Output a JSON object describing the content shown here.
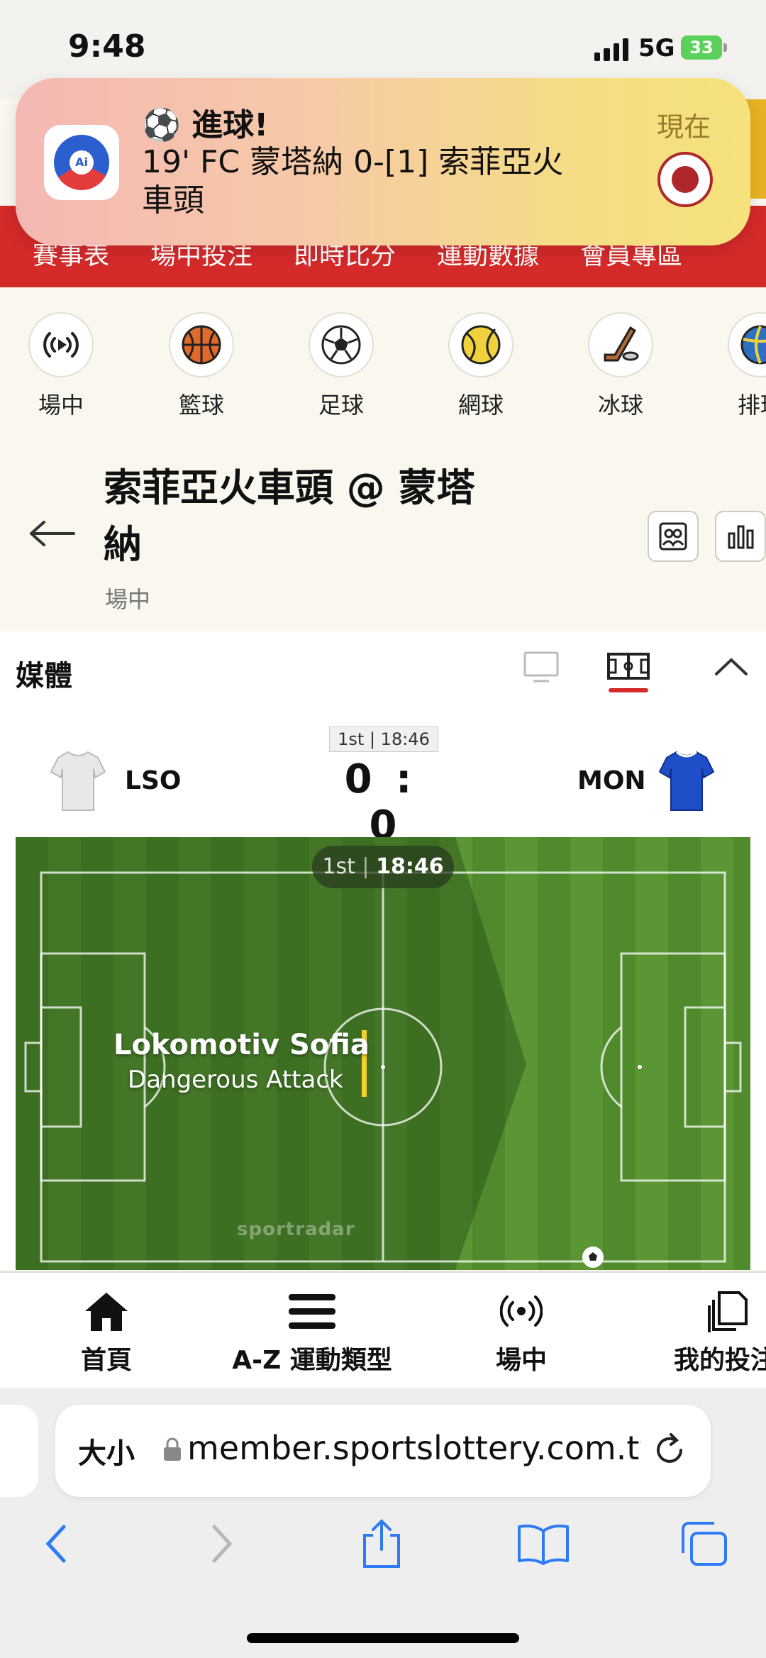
{
  "status_bar": {
    "time": "9:48",
    "network": "5G",
    "battery": "33"
  },
  "notification": {
    "title": "⚽ 進球!",
    "body": "19' FC 蒙塔納 0-[1] 索菲亞火車頭",
    "time": "現在",
    "app_icon_label": "Ai"
  },
  "top_nav": {
    "items": [
      "賽事表",
      "場中投注",
      "即時比分",
      "運動數據",
      "會員專區"
    ]
  },
  "sports": [
    {
      "label": "場中",
      "icon": "live-icon"
    },
    {
      "label": "籃球",
      "icon": "basketball-icon"
    },
    {
      "label": "足球",
      "icon": "soccer-icon"
    },
    {
      "label": "網球",
      "icon": "tennis-icon"
    },
    {
      "label": "冰球",
      "icon": "ice-hockey-icon"
    },
    {
      "label": "排球",
      "icon": "volleyball-icon"
    }
  ],
  "match": {
    "title": "索菲亞火車頭 @ 蒙塔納",
    "subtitle": "場中"
  },
  "media": {
    "label": "媒體",
    "period": "1st | 18:46",
    "home_abbr": "LSO",
    "away_abbr": "MON",
    "home_score": "0",
    "away_score": "0",
    "separator": ":"
  },
  "pitch": {
    "period": "1st",
    "clock": "18:46",
    "team": "Lokomotiv Sofia",
    "action": "Dangerous Attack",
    "watermark": "sportradar"
  },
  "bottom_nav": [
    {
      "label": "首頁",
      "icon": "home-icon"
    },
    {
      "label": "A-Z 運動類型",
      "icon": "menu-icon"
    },
    {
      "label": "場中",
      "icon": "live-icon"
    },
    {
      "label": "我的投注",
      "icon": "copy-icon"
    }
  ],
  "safari": {
    "text_size_label": "大小",
    "url": "member.sportslottery.com.tw"
  }
}
